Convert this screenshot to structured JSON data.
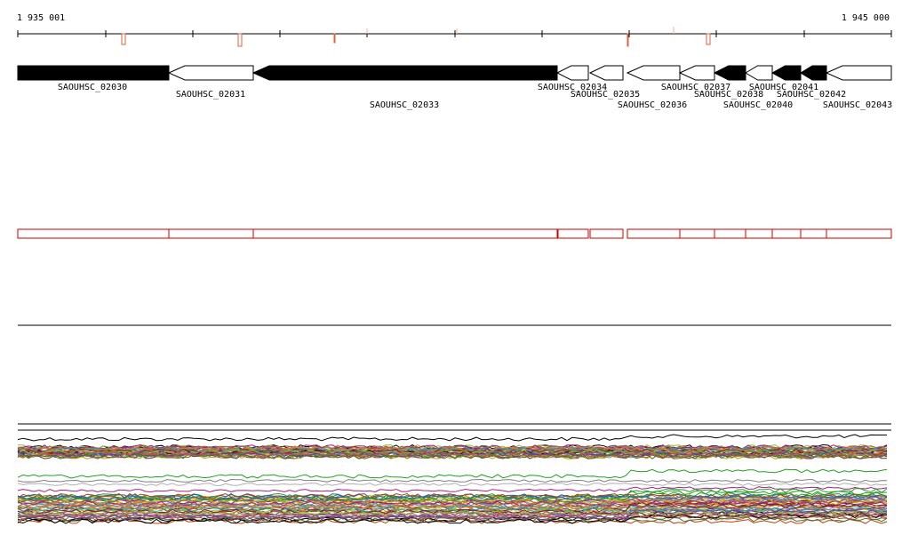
{
  "coordinates": {
    "start": "1 935 001",
    "end": "1 945 000"
  },
  "colors": {
    "filled_gene": "#000000",
    "open_gene": "#ffffff",
    "outline": "#000000",
    "region_box": "#cc0000",
    "tick_marker": "#e06040"
  },
  "genes": [
    {
      "name": "SAOUHSC_02030",
      "strand": "+",
      "filled": true
    },
    {
      "name": "SAOUHSC_02031",
      "strand": "-",
      "filled": false
    },
    {
      "name": "SAOUHSC_02033",
      "strand": "-",
      "filled": true
    },
    {
      "name": "SAOUHSC_02034",
      "strand": "-",
      "filled": false
    },
    {
      "name": "SAOUHSC_02035",
      "strand": "-",
      "filled": false
    },
    {
      "name": "SAOUHSC_02036",
      "strand": "-",
      "filled": false
    },
    {
      "name": "SAOUHSC_02037",
      "strand": "-",
      "filled": false
    },
    {
      "name": "SAOUHSC_02038",
      "strand": "-",
      "filled": true
    },
    {
      "name": "SAOUHSC_02040",
      "strand": "-",
      "filled": false
    },
    {
      "name": "SAOUHSC_02041",
      "strand": "-",
      "filled": true
    },
    {
      "name": "SAOUHSC_02042",
      "strand": "-",
      "filled": true
    },
    {
      "name": "SAOUHSC_02043",
      "strand": "-",
      "filled": false
    }
  ],
  "line_palette": [
    "#000000",
    "#c04000",
    "#2060c0",
    "#20a020",
    "#c0a000",
    "#a02080",
    "#808080",
    "#e08020",
    "#40a0a0",
    "#802020",
    "#90c030",
    "#b06060",
    "#6040a0",
    "#d05050",
    "#507030"
  ]
}
